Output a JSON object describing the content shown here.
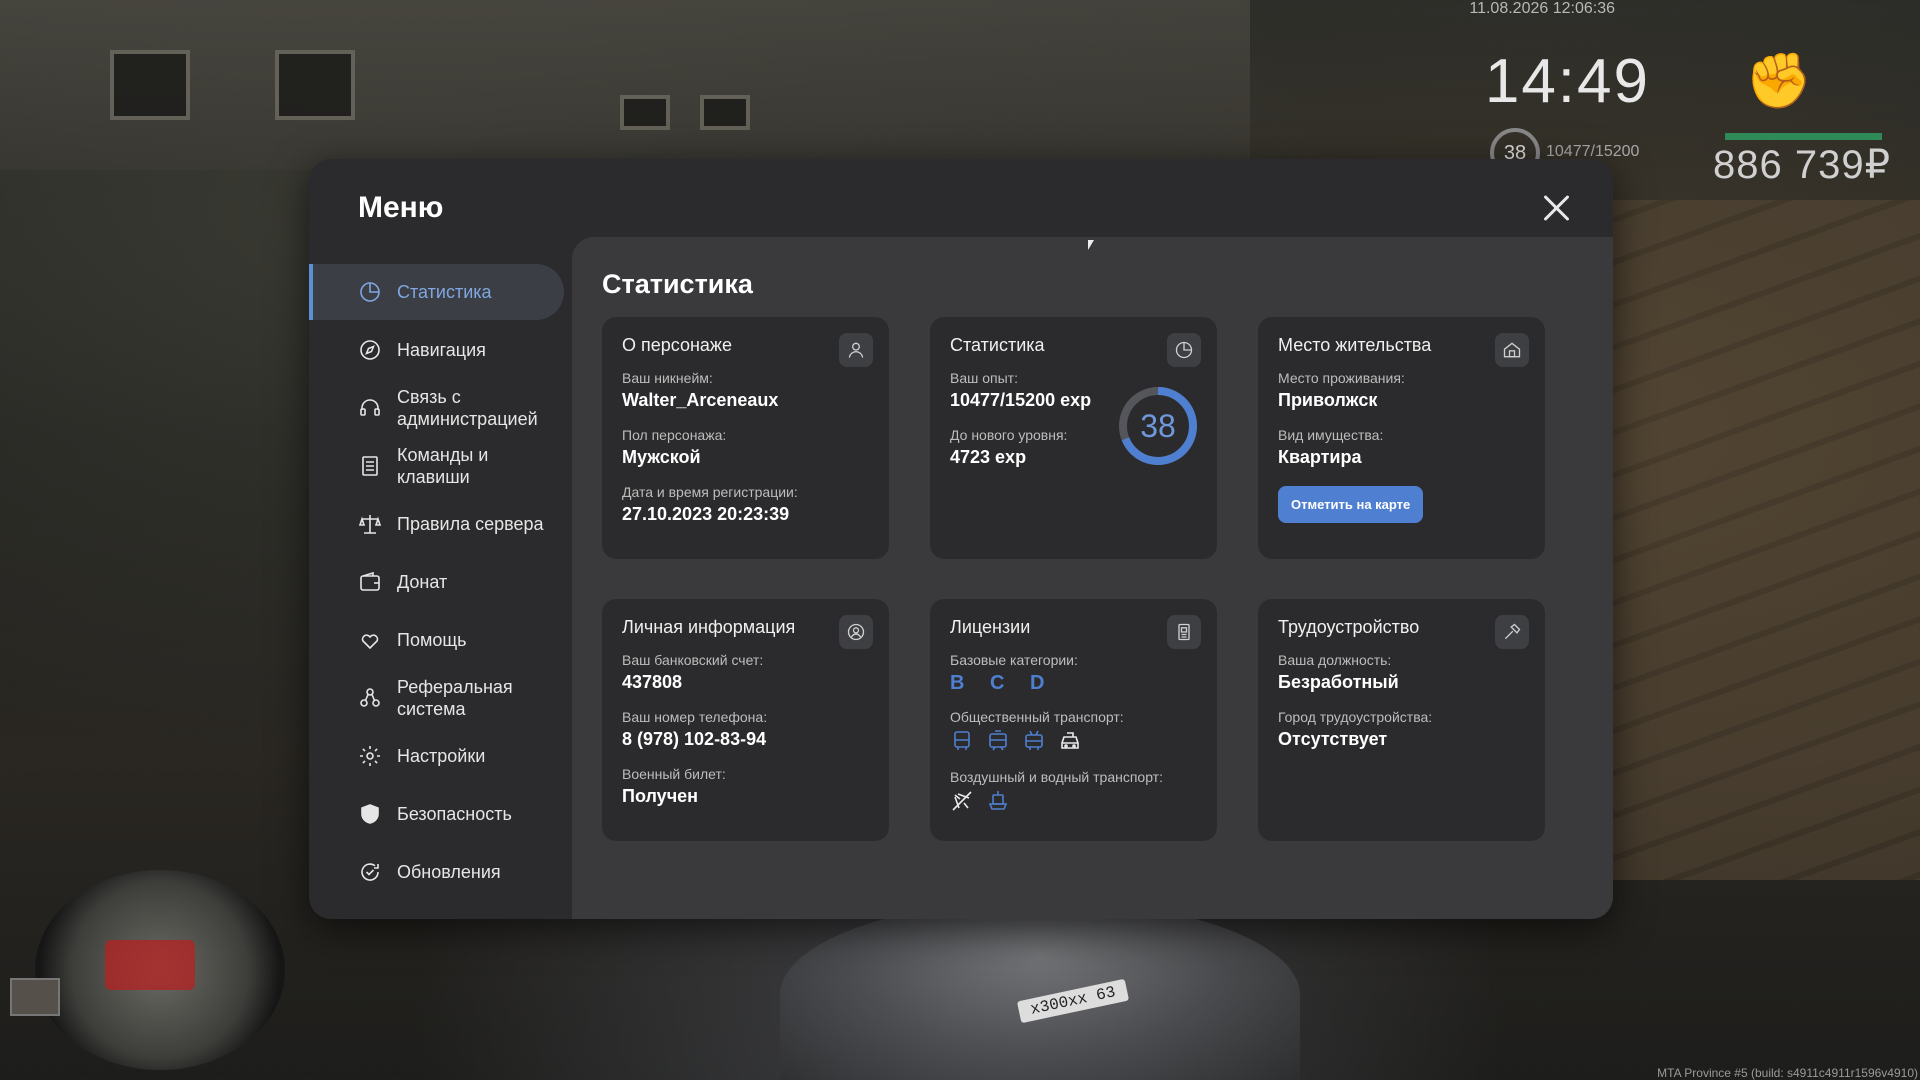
{
  "hud": {
    "datetime": "11.08.2026 12:06:36",
    "time": "14:49",
    "level": "38",
    "exp": "10477/15200",
    "money": "886 739₽",
    "build": "MTA Province #5 (build: s4911c4911r1596v4910)",
    "plate": "x300xx 63"
  },
  "modal": {
    "title": "Меню"
  },
  "sidebar": {
    "items": [
      {
        "label": "Статистика",
        "icon": "pie-chart-icon"
      },
      {
        "label": "Навигация",
        "icon": "compass-icon"
      },
      {
        "label": "Связь с\nадминистрацией",
        "icon": "headset-icon"
      },
      {
        "label": "Команды и\nклавиши",
        "icon": "document-list-icon"
      },
      {
        "label": "Правила сервера",
        "icon": "scales-icon"
      },
      {
        "label": "Донат",
        "icon": "wallet-icon"
      },
      {
        "label": "Помощь",
        "icon": "heart-hands-icon"
      },
      {
        "label": "Реферальная\nсистема",
        "icon": "referral-icon"
      },
      {
        "label": "Настройки",
        "icon": "gear-icon"
      },
      {
        "label": "Безопасность",
        "icon": "shield-icon"
      },
      {
        "label": "Обновления",
        "icon": "refresh-check-icon"
      }
    ]
  },
  "content": {
    "title": "Статистика",
    "character": {
      "title": "О персонаже",
      "nick_label": "Ваш никнейм:",
      "nick": "Walter_Arceneaux",
      "gender_label": "Пол персонажа:",
      "gender": "Мужской",
      "reg_label": "Дата и время регистрации:",
      "reg": "27.10.2023 20:23:39"
    },
    "stats": {
      "title": "Статистика",
      "exp_label": "Ваш опыт:",
      "exp": "10477/15200 exp",
      "next_label": "До нового уровня:",
      "next": "4723 exp",
      "level": "38",
      "progress": 0.689
    },
    "residence": {
      "title": "Место жительства",
      "place_label": "Место проживания:",
      "place": "Приволжск",
      "type_label": "Вид имущества:",
      "type": "Квартира",
      "button": "Отметить на карте"
    },
    "personal": {
      "title": "Личная информация",
      "bank_label": "Ваш банковский счет:",
      "bank": "437808",
      "phone_label": "Ваш номер телефона:",
      "phone": "8 (978) 102-83-94",
      "military_label": "Военный билет:",
      "military": "Получен"
    },
    "licenses": {
      "title": "Лицензии",
      "basic_label": "Базовые категории:",
      "basic": "B C D",
      "public_label": "Общественный транспорт:",
      "air_label": "Воздушный и водный транспорт:"
    },
    "job": {
      "title": "Трудоустройство",
      "position_label": "Ваша должность:",
      "position": "Безработный",
      "city_label": "Город трудоустройства:",
      "city": "Отсутствует"
    }
  },
  "colors": {
    "accent": "#4f7fd0",
    "panel": "#2b2b2d",
    "content_bg": "#3a3a3c"
  }
}
